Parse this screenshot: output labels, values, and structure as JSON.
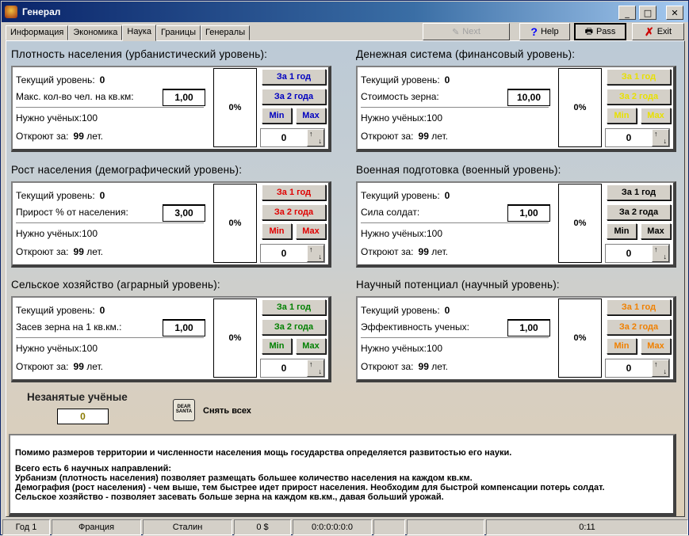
{
  "window": {
    "title": "Генерал",
    "minimize": "_",
    "maximize": "□",
    "close": "✕"
  },
  "tabs": [
    "Информация",
    "Экономика",
    "Наука",
    "Границы",
    "Генералы"
  ],
  "toolbar": {
    "next": "Next",
    "help": "Help",
    "pass": "Pass",
    "exit": "Exit"
  },
  "common": {
    "current_level": "Текущий уровень:",
    "need_scientists": "Нужно учёных:",
    "open_in": "Откроют за:",
    "years": "лет.",
    "for_1_year": "За 1 год",
    "for_2_years": "За 2 года",
    "min": "Min",
    "max": "Max"
  },
  "sections": [
    {
      "title": "Плотность населения (урбанистический уровень):",
      "level": "0",
      "param": "Макс. кол-во чел. на кв.км:",
      "value": "1,00",
      "need": "100",
      "years": "99",
      "pct": "0%",
      "spin": "0",
      "color": "#0000c0"
    },
    {
      "title": "Денежная система (финансовый уровень):",
      "level": "0",
      "param": "Стоимость зерна:",
      "value": "10,00",
      "need": "100",
      "years": "99",
      "pct": "0%",
      "spin": "0",
      "color": "#e8e000"
    },
    {
      "title": "Рост населения (демографический уровень):",
      "level": "0",
      "param": "Прирост % от населения:",
      "value": "3,00",
      "need": "100",
      "years": "99",
      "pct": "0%",
      "spin": "0",
      "color": "#e00000"
    },
    {
      "title": "Военная подготовка (военный уровень):",
      "level": "0",
      "param": "Сила солдат:",
      "value": "1,00",
      "need": "100",
      "years": "99",
      "pct": "0%",
      "spin": "0",
      "color": "#000000"
    },
    {
      "title": "Сельское хозяйство (аграрный уровень):",
      "level": "0",
      "param": "Засев зерна на 1 кв.км.:",
      "value": "1,00",
      "need": "100",
      "years": "99",
      "pct": "0%",
      "spin": "0",
      "color": "#008000"
    },
    {
      "title": "Научный потенциал (научный уровень):",
      "level": "0",
      "param": "Эффективность ученых:",
      "value": "1,00",
      "need": "100",
      "years": "99",
      "pct": "0%",
      "spin": "0",
      "color": "#f08000"
    }
  ],
  "idle": {
    "label": "Незанятые учёные",
    "value": "0",
    "remove_all": "Снять всех",
    "icon_text": "DEAR SANTA"
  },
  "description": [
    "Помимо размеров территории и численности населения мощь государства определяется развитостью его науки.",
    "",
    "Всего есть 6 научных направлений:",
    "Урбанизм (плотность населения) позволяет размещать большее количество населения на каждом кв.км.",
    "Демография (рост населения) - чем выше, тем быстрее идет прирост населения. Необходим для быстрой компенсации потерь солдат.",
    "Сельское хозяйство - позволяет засевать больше зерна на каждом кв.км., давая больший урожай."
  ],
  "status": [
    "Год 1",
    "Франция",
    "Сталин",
    "0 $",
    "0:0:0:0:0:0",
    "",
    "",
    "0:11"
  ]
}
